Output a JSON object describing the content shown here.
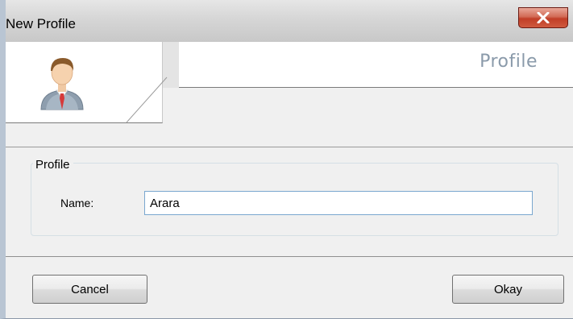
{
  "window": {
    "title": "New Profile"
  },
  "header": {
    "caption": "Profile",
    "icon": "user-avatar-icon"
  },
  "profile_group": {
    "legend": "Profile",
    "name_label": "Name:",
    "name_value": "Arara"
  },
  "buttons": {
    "cancel": "Cancel",
    "okay": "Okay"
  },
  "icons": {
    "close": "close-icon",
    "avatar": "user-avatar-icon"
  },
  "colors": {
    "close_button": "#c8472f",
    "caption_text": "#8a9aaa",
    "input_border": "#7aa7cf"
  }
}
